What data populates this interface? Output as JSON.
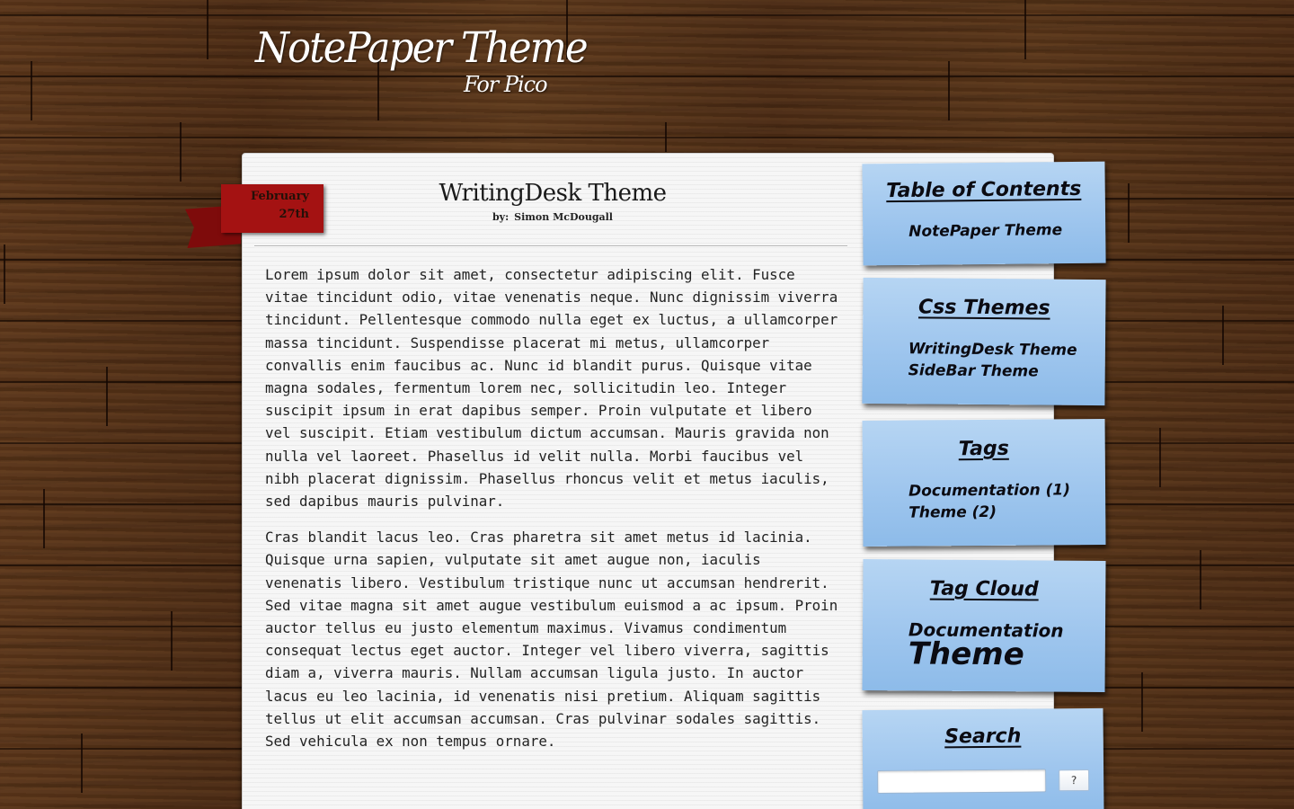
{
  "site": {
    "title": "NotePaper Theme",
    "subtitle": "For Pico"
  },
  "post": {
    "date_month": "February",
    "date_day": "27th",
    "title": "WritingDesk Theme",
    "author_prefix": "by:",
    "author_name": "Simon McDougall",
    "paragraphs": [
      "Lorem ipsum dolor sit amet, consectetur adipiscing elit. Fusce vitae tincidunt odio, vitae venenatis neque. Nunc dignissim viverra tincidunt. Pellentesque commodo nulla eget ex luctus, a ullamcorper massa tincidunt. Suspendisse placerat mi metus, ullamcorper convallis enim faucibus ac. Nunc id blandit purus. Quisque vitae magna sodales, fermentum lorem nec, sollicitudin leo. Integer suscipit ipsum in erat dapibus semper. Proin vulputate et libero vel suscipit. Etiam vestibulum dictum accumsan. Mauris gravida non nulla vel laoreet. Phasellus id velit nulla. Morbi faucibus vel nibh placerat dignissim. Phasellus rhoncus velit et metus iaculis, sed dapibus mauris pulvinar.",
      "Cras blandit lacus leo. Cras pharetra sit amet metus id lacinia. Quisque urna sapien, vulputate sit amet augue non, iaculis venenatis libero. Vestibulum tristique nunc ut accumsan hendrerit. Sed vitae magna sit amet augue vestibulum euismod a ac ipsum. Proin auctor tellus eu justo elementum maximus. Vivamus condimentum consequat lectus eget auctor. Integer vel libero viverra, sagittis diam a, viverra mauris. Nullam accumsan ligula justo. In auctor lacus eu leo lacinia, id venenatis nisi pretium. Aliquam sagittis tellus ut elit accumsan accumsan. Cras pulvinar sodales sagittis. Sed vehicula ex non tempus ornare."
    ]
  },
  "sidebar": {
    "toc": {
      "heading": "Table of Contents",
      "items": [
        "NotePaper Theme"
      ]
    },
    "css_themes": {
      "heading": "Css Themes",
      "items": [
        "WritingDesk Theme",
        "SideBar Theme"
      ]
    },
    "tags": {
      "heading": "Tags",
      "items": [
        "Documentation (1)",
        "Theme (2)"
      ]
    },
    "tag_cloud": {
      "heading": "Tag Cloud",
      "items": [
        "Documentation",
        "Theme"
      ]
    },
    "search": {
      "heading": "Search",
      "input_value": "",
      "button_label": "?"
    }
  },
  "colors": {
    "wood": "#4e2f17",
    "paper": "#f6f6f6",
    "ribbon": "#a41212",
    "sticky_note": "#9fc6ee",
    "logo_text": "#ffffff"
  }
}
